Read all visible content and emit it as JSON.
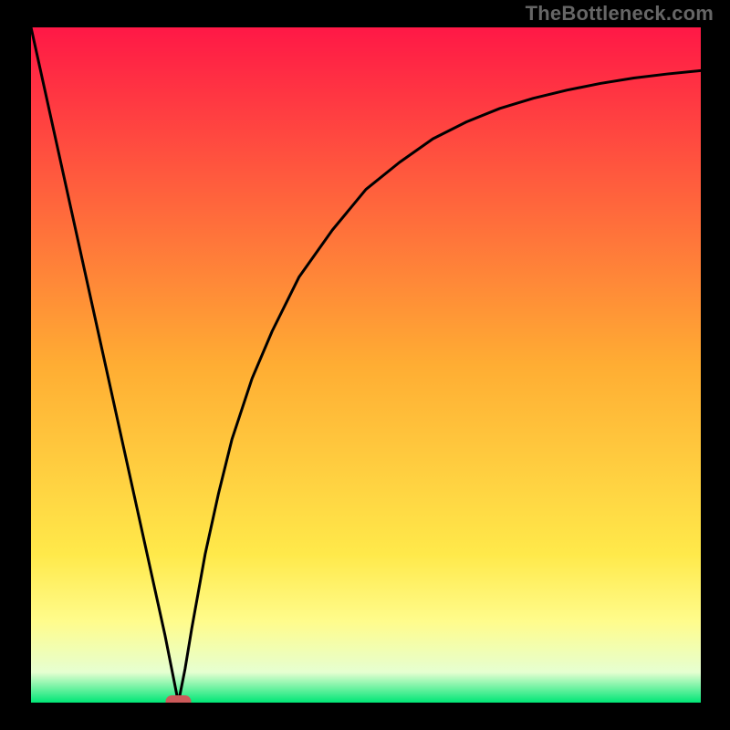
{
  "attribution": "TheBottleneck.com",
  "chart_data": {
    "type": "line",
    "title": "",
    "xlabel": "",
    "ylabel": "",
    "xlim": [
      0,
      100
    ],
    "ylim": [
      0,
      100
    ],
    "grid": false,
    "legend": false,
    "gradient_stops": [
      {
        "pos": 0.0,
        "color": "#ff1846"
      },
      {
        "pos": 0.5,
        "color": "#ffad33"
      },
      {
        "pos": 0.78,
        "color": "#ffe94a"
      },
      {
        "pos": 0.88,
        "color": "#fffc8c"
      },
      {
        "pos": 0.955,
        "color": "#e6ffd1"
      },
      {
        "pos": 1.0,
        "color": "#00e676"
      }
    ],
    "marker": {
      "x": 22,
      "y": 0,
      "color": "#cc5a5a",
      "shape": "rounded-rect"
    },
    "series": [
      {
        "name": "bottleneck-curve",
        "type": "line",
        "x": [
          0,
          2,
          4,
          6,
          8,
          10,
          12,
          14,
          16,
          18,
          20,
          21,
          22,
          23,
          24,
          26,
          28,
          30,
          33,
          36,
          40,
          45,
          50,
          55,
          60,
          65,
          70,
          75,
          80,
          85,
          90,
          95,
          100
        ],
        "y": [
          100,
          91,
          82,
          73,
          64,
          55,
          46,
          37,
          28,
          19,
          10,
          5,
          0,
          5,
          11,
          22,
          31,
          39,
          48,
          55,
          63,
          70,
          76,
          80,
          83.5,
          86,
          88,
          89.5,
          90.7,
          91.7,
          92.5,
          93.1,
          93.6
        ]
      }
    ]
  }
}
